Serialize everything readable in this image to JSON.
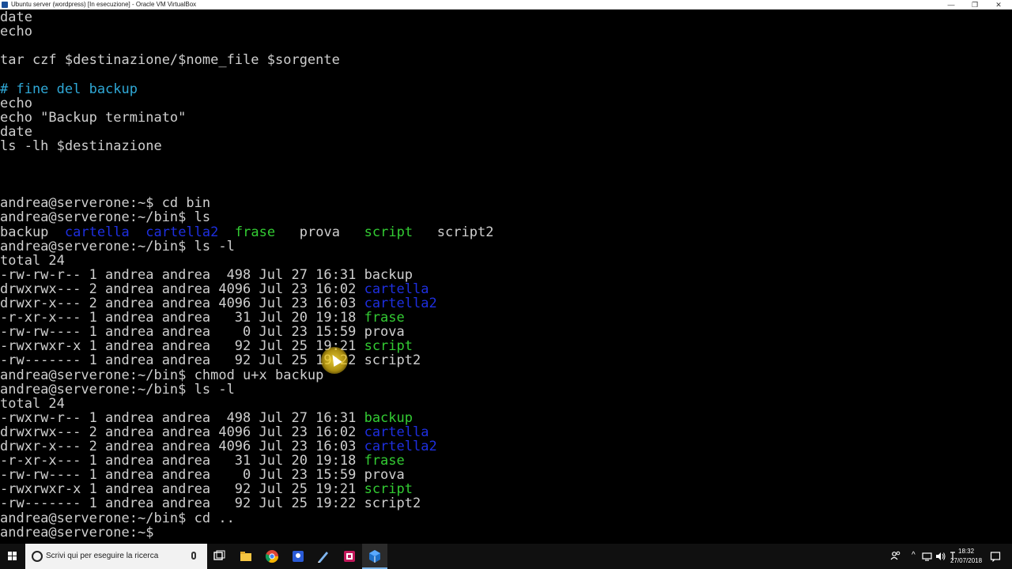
{
  "window": {
    "title": "Ubuntu server (wordpress) [In esecuzione] - Oracle VM VirtualBox",
    "min_glyph": "—",
    "max_glyph": "❐",
    "close_glyph": "✕"
  },
  "colors": {
    "comment": "#2fa8d6",
    "directory": "#1e2fe0",
    "executable": "#33cc33",
    "text": "#cfcfcf",
    "background": "#000000"
  },
  "console": {
    "lines": [
      [
        {
          "t": "date"
        }
      ],
      [
        {
          "t": "echo"
        }
      ],
      [
        {
          "t": ""
        }
      ],
      [
        {
          "t": "tar czf $destinazione/$nome_file $sorgente"
        }
      ],
      [
        {
          "t": ""
        }
      ],
      [
        {
          "t": "# fine del backup",
          "c": "comment"
        }
      ],
      [
        {
          "t": "echo"
        }
      ],
      [
        {
          "t": "echo \"Backup terminato\""
        }
      ],
      [
        {
          "t": "date"
        }
      ],
      [
        {
          "t": "ls -lh $destinazione"
        }
      ],
      [
        {
          "t": ""
        }
      ],
      [
        {
          "t": ""
        }
      ],
      [
        {
          "t": ""
        }
      ],
      [
        {
          "t": "andrea@serverone:~$ cd bin"
        }
      ],
      [
        {
          "t": "andrea@serverone:~/bin$ ls"
        }
      ],
      [
        {
          "t": "backup  "
        },
        {
          "t": "cartella",
          "c": "dir"
        },
        {
          "t": "  "
        },
        {
          "t": "cartella2",
          "c": "dir"
        },
        {
          "t": "  "
        },
        {
          "t": "frase",
          "c": "exe"
        },
        {
          "t": "   prova   "
        },
        {
          "t": "script",
          "c": "exe"
        },
        {
          "t": "   script2"
        }
      ],
      [
        {
          "t": "andrea@serverone:~/bin$ ls -l"
        }
      ],
      [
        {
          "t": "total 24"
        }
      ],
      [
        {
          "t": "-rw-rw-r-- 1 andrea andrea  498 Jul 27 16:31 backup"
        }
      ],
      [
        {
          "t": "drwxrwx--- 2 andrea andrea 4096 Jul 23 16:02 "
        },
        {
          "t": "cartella",
          "c": "dir"
        }
      ],
      [
        {
          "t": "drwxr-x--- 2 andrea andrea 4096 Jul 23 16:03 "
        },
        {
          "t": "cartella2",
          "c": "dir"
        }
      ],
      [
        {
          "t": "-r-xr-x--- 1 andrea andrea   31 Jul 20 19:18 "
        },
        {
          "t": "frase",
          "c": "exe"
        }
      ],
      [
        {
          "t": "-rw-rw---- 1 andrea andrea    0 Jul 23 15:59 prova"
        }
      ],
      [
        {
          "t": "-rwxrwxr-x 1 andrea andrea   92 Jul 25 19:21 "
        },
        {
          "t": "script",
          "c": "exe"
        }
      ],
      [
        {
          "t": "-rw------- 1 andrea andrea   92 Jul 25 19:22 script2"
        }
      ],
      [
        {
          "t": "andrea@serverone:~/bin$ chmod u+x backup"
        }
      ],
      [
        {
          "t": "andrea@serverone:~/bin$ ls -l"
        }
      ],
      [
        {
          "t": "total 24"
        }
      ],
      [
        {
          "t": "-rwxrw-r-- 1 andrea andrea  498 Jul 27 16:31 "
        },
        {
          "t": "backup",
          "c": "exe"
        }
      ],
      [
        {
          "t": "drwxrwx--- 2 andrea andrea 4096 Jul 23 16:02 "
        },
        {
          "t": "cartella",
          "c": "dir"
        }
      ],
      [
        {
          "t": "drwxr-x--- 2 andrea andrea 4096 Jul 23 16:03 "
        },
        {
          "t": "cartella2",
          "c": "dir"
        }
      ],
      [
        {
          "t": "-r-xr-x--- 1 andrea andrea   31 Jul 20 19:18 "
        },
        {
          "t": "frase",
          "c": "exe"
        }
      ],
      [
        {
          "t": "-rw-rw---- 1 andrea andrea    0 Jul 23 15:59 prova"
        }
      ],
      [
        {
          "t": "-rwxrwxr-x 1 andrea andrea   92 Jul 25 19:21 "
        },
        {
          "t": "script",
          "c": "exe"
        }
      ],
      [
        {
          "t": "-rw------- 1 andrea andrea   92 Jul 25 19:22 script2"
        }
      ],
      [
        {
          "t": "andrea@serverone:~/bin$ cd .."
        }
      ],
      [
        {
          "t": "andrea@serverone:~$ "
        }
      ]
    ]
  },
  "taskbar": {
    "search_placeholder": "Scrivi qui per eseguire la ricerca",
    "pinned_icons": [
      "task-view-icon",
      "file-explorer-icon",
      "chrome-icon",
      "app-blue-icon",
      "app-pen-icon",
      "app-pink-icon",
      "virtualbox-icon"
    ],
    "tray": {
      "time": "18:32",
      "date": "27/07/2018",
      "chevron": "^"
    }
  }
}
